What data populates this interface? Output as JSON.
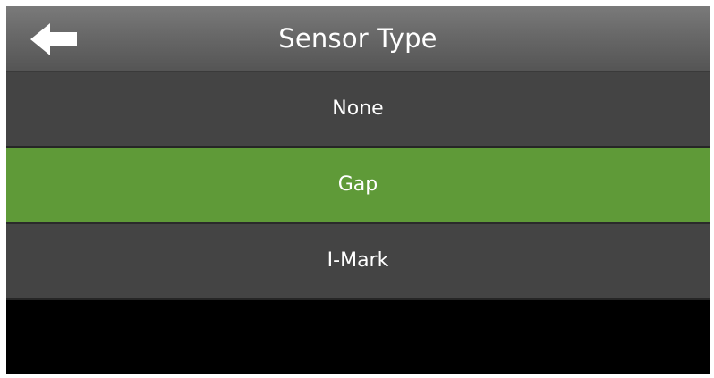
{
  "header": {
    "title": "Sensor Type",
    "back_icon": "left-arrow-icon"
  },
  "options": [
    {
      "label": "None",
      "selected": false
    },
    {
      "label": "Gap",
      "selected": true
    },
    {
      "label": "I-Mark",
      "selected": false
    }
  ],
  "colors": {
    "selected_background": "#5f9a38",
    "option_background": "#444444",
    "header_background": "#686868",
    "screen_background": "#000000",
    "text": "#ffffff"
  }
}
